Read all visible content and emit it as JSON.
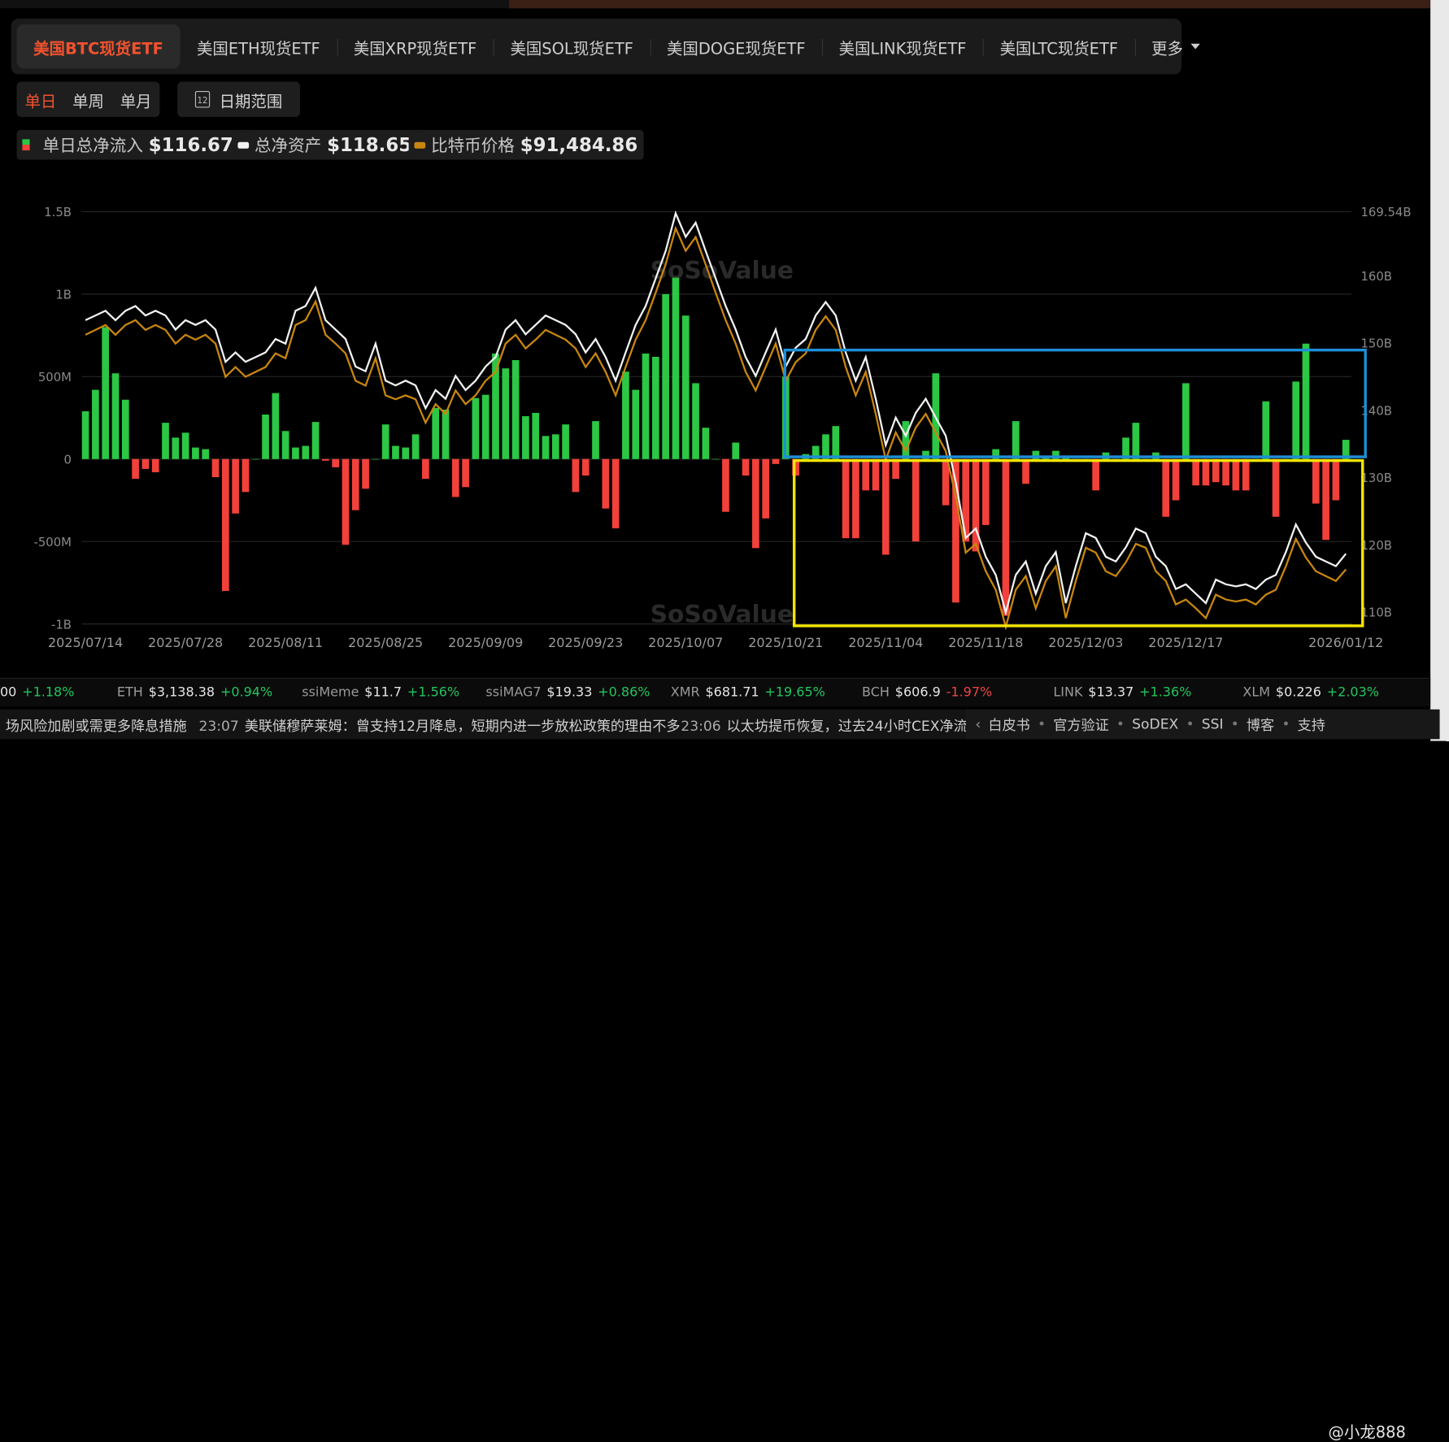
{
  "tabs": [
    {
      "label": "美国BTC现货ETF",
      "active": true
    },
    {
      "label": "美国ETH现货ETF"
    },
    {
      "label": "美国XRP现货ETF"
    },
    {
      "label": "美国SOL现货ETF"
    },
    {
      "label": "美国DOGE现货ETF"
    },
    {
      "label": "美国LINK现货ETF"
    },
    {
      "label": "美国LTC现货ETF"
    },
    {
      "label": "更多"
    }
  ],
  "periods": [
    "单日",
    "单周",
    "单月"
  ],
  "date_range_label": "日期范围",
  "calendar_icon_text": "12",
  "legend": [
    {
      "label": "单日总净流入",
      "value": "$116.67M"
    },
    {
      "label": "总净资产",
      "value": "$118.65B"
    },
    {
      "label": "比特币价格",
      "value": "$91,484.86"
    }
  ],
  "colors": {
    "inflow": "#2bc745",
    "outflow": "#f2403a",
    "assets": "#f2f2f2",
    "price": "#c8860f",
    "active": "#f2522e",
    "blue_box": "#1e8fd8",
    "yellow_box": "#f3e400"
  },
  "watermark": "SoSoValue",
  "chart_data": {
    "type": "bar+line",
    "left_axis": {
      "ticks": [
        "1.5B",
        "1B",
        "500M",
        "0",
        "-500M",
        "-1B"
      ],
      "tick_values": [
        1500,
        1000,
        500,
        0,
        -500,
        -1000
      ],
      "range": [
        -1000,
        1500
      ],
      "unit": "M USD"
    },
    "right_axis": {
      "ticks": [
        "169.54B",
        "160B",
        "150B",
        "140B",
        "130B",
        "120B",
        "110B"
      ],
      "tick_values": [
        169.54,
        160,
        150,
        140,
        130,
        120,
        110
      ],
      "range": [
        108.2,
        169.54
      ],
      "unit": "B USD"
    },
    "price_axis_range": [
      85.9,
      128.1
    ],
    "x_ticks": [
      {
        "label": "2025/07/14",
        "index": 0
      },
      {
        "label": "2025/07/28",
        "index": 10
      },
      {
        "label": "2025/08/11",
        "index": 20
      },
      {
        "label": "2025/08/25",
        "index": 30
      },
      {
        "label": "2025/09/09",
        "index": 40
      },
      {
        "label": "2025/09/23",
        "index": 50
      },
      {
        "label": "2025/10/07",
        "index": 60
      },
      {
        "label": "2025/10/21",
        "index": 70
      },
      {
        "label": "2025/11/04",
        "index": 80
      },
      {
        "label": "2025/11/18",
        "index": 90
      },
      {
        "label": "2025/12/03",
        "index": 100
      },
      {
        "label": "2025/12/17",
        "index": 110
      },
      {
        "label": "2026/01/12",
        "index": 126
      }
    ],
    "daily_net_inflow_musd": [
      290,
      420,
      800,
      520,
      360,
      -120,
      -60,
      -80,
      220,
      130,
      160,
      70,
      60,
      -110,
      -800,
      -330,
      -200,
      0,
      270,
      400,
      170,
      70,
      80,
      225,
      -10,
      -50,
      -520,
      -310,
      -180,
      0,
      210,
      80,
      70,
      150,
      -120,
      310,
      300,
      -230,
      -170,
      370,
      390,
      640,
      550,
      600,
      260,
      280,
      140,
      150,
      210,
      -200,
      -100,
      230,
      -300,
      -420,
      530,
      420,
      640,
      620,
      1000,
      1100,
      870,
      460,
      190,
      0,
      -320,
      100,
      -100,
      -540,
      -360,
      -30,
      500,
      -100,
      30,
      80,
      150,
      200,
      -480,
      -480,
      -190,
      -190,
      -580,
      -120,
      230,
      -500,
      50,
      520,
      -280,
      -870,
      -500,
      -560,
      -400,
      60,
      -950,
      230,
      -150,
      50,
      10,
      50,
      20,
      0,
      0,
      -190,
      40,
      0,
      130,
      220,
      0,
      40,
      -350,
      -250,
      460,
      -160,
      -160,
      -140,
      -160,
      -190,
      -190,
      0,
      350,
      -350,
      0,
      470,
      700,
      -270,
      -490,
      -250,
      116.67
    ],
    "total_net_assets_busd": [
      153.4,
      154.1,
      154.8,
      153.4,
      154.8,
      155.5,
      154.1,
      154.8,
      154.1,
      152.0,
      153.4,
      152.7,
      153.4,
      152.0,
      147.2,
      148.6,
      147.2,
      147.9,
      148.6,
      150.6,
      149.9,
      154.8,
      155.5,
      158.2,
      153.4,
      152.0,
      150.6,
      146.5,
      145.8,
      149.9,
      144.4,
      143.7,
      144.4,
      143.7,
      140.3,
      143.0,
      141.7,
      145.1,
      143.0,
      144.4,
      146.5,
      147.9,
      152.0,
      153.4,
      151.3,
      152.7,
      154.1,
      153.4,
      152.7,
      151.3,
      148.6,
      150.6,
      147.9,
      144.4,
      148.6,
      152.7,
      155.5,
      159.6,
      163.7,
      169.3,
      165.8,
      167.9,
      163.7,
      159.6,
      155.5,
      152.0,
      147.9,
      145.1,
      148.6,
      152.0,
      146.5,
      149.3,
      150.6,
      154.1,
      156.1,
      154.1,
      148.6,
      144.4,
      147.9,
      141.7,
      134.8,
      138.9,
      136.2,
      139.6,
      141.7,
      138.9,
      136.2,
      129.3,
      121.0,
      122.4,
      118.2,
      115.5,
      109.9,
      115.5,
      117.5,
      112.7,
      116.8,
      118.9,
      111.3,
      116.8,
      121.7,
      121.0,
      118.2,
      117.5,
      119.6,
      122.4,
      121.7,
      118.2,
      116.8,
      113.4,
      114.1,
      112.7,
      111.3,
      114.8,
      114.1,
      113.8,
      114.1,
      113.4,
      114.8,
      115.5,
      118.9,
      123.0,
      120.3,
      118.2,
      117.5,
      116.8,
      118.65
    ],
    "btc_price_kusd": [
      115.5,
      116.0,
      116.5,
      115.5,
      116.5,
      117.0,
      116.0,
      116.5,
      116.0,
      114.6,
      115.5,
      115.0,
      115.5,
      114.6,
      111.2,
      112.2,
      111.2,
      111.7,
      112.2,
      113.6,
      113.1,
      116.5,
      117.0,
      118.9,
      115.5,
      114.6,
      113.6,
      110.8,
      110.3,
      113.1,
      109.3,
      108.9,
      109.3,
      108.9,
      106.5,
      108.4,
      107.4,
      109.8,
      108.4,
      109.3,
      110.8,
      111.7,
      114.6,
      115.5,
      114.1,
      115.0,
      116.0,
      115.5,
      115.0,
      114.1,
      112.2,
      113.6,
      111.7,
      109.3,
      112.2,
      115.0,
      117.0,
      119.8,
      122.7,
      126.4,
      124.1,
      125.5,
      122.7,
      119.8,
      117.0,
      114.6,
      111.7,
      109.8,
      112.2,
      114.6,
      110.8,
      112.7,
      113.6,
      116.0,
      117.4,
      116.0,
      112.2,
      109.3,
      111.7,
      107.4,
      102.7,
      105.5,
      103.6,
      106.0,
      107.4,
      105.5,
      103.6,
      98.9,
      93.2,
      94.1,
      91.3,
      89.4,
      85.6,
      89.4,
      90.8,
      87.5,
      90.3,
      91.8,
      86.5,
      90.3,
      93.7,
      93.2,
      91.3,
      90.8,
      92.2,
      94.1,
      93.7,
      91.3,
      90.3,
      87.9,
      88.4,
      87.5,
      86.5,
      88.9,
      88.4,
      88.2,
      88.4,
      87.9,
      88.9,
      89.4,
      91.8,
      94.6,
      92.7,
      91.3,
      90.8,
      90.3,
      91.48
    ]
  },
  "ticker": [
    {
      "sym": "",
      "price": "00",
      "chg": "+1.18%",
      "dir": "up"
    },
    {
      "sym": "ETH",
      "price": "$3,138.38",
      "chg": "+0.94%",
      "dir": "up"
    },
    {
      "sym": "ssiMeme",
      "price": "$11.7",
      "chg": "+1.56%",
      "dir": "up"
    },
    {
      "sym": "ssiMAG7",
      "price": "$19.33",
      "chg": "+0.86%",
      "dir": "up"
    },
    {
      "sym": "XMR",
      "price": "$681.71",
      "chg": "+19.65%",
      "dir": "up"
    },
    {
      "sym": "BCH",
      "price": "$606.9",
      "chg": "-1.97%",
      "dir": "dn"
    },
    {
      "sym": "LINK",
      "price": "$13.37",
      "chg": "+1.36%",
      "dir": "up"
    },
    {
      "sym": "XLM",
      "price": "$0.226",
      "chg": "+2.03%",
      "dir": "up"
    }
  ],
  "news": [
    {
      "time": "",
      "text": "场风险加剧或需更多降息措施"
    },
    {
      "time": "23:07",
      "text": "美联储穆萨莱姆：曾支持12月降息，短期内进一步放松政策的理由不多"
    },
    {
      "time": "23:06",
      "text": "以太坊提币恢复，过去24小时CEX净流出"
    }
  ],
  "footer_links": [
    "白皮书",
    "官方验证",
    "SoDEX",
    "SSI",
    "博客",
    "支持"
  ],
  "user_watermark": "@小龙888"
}
